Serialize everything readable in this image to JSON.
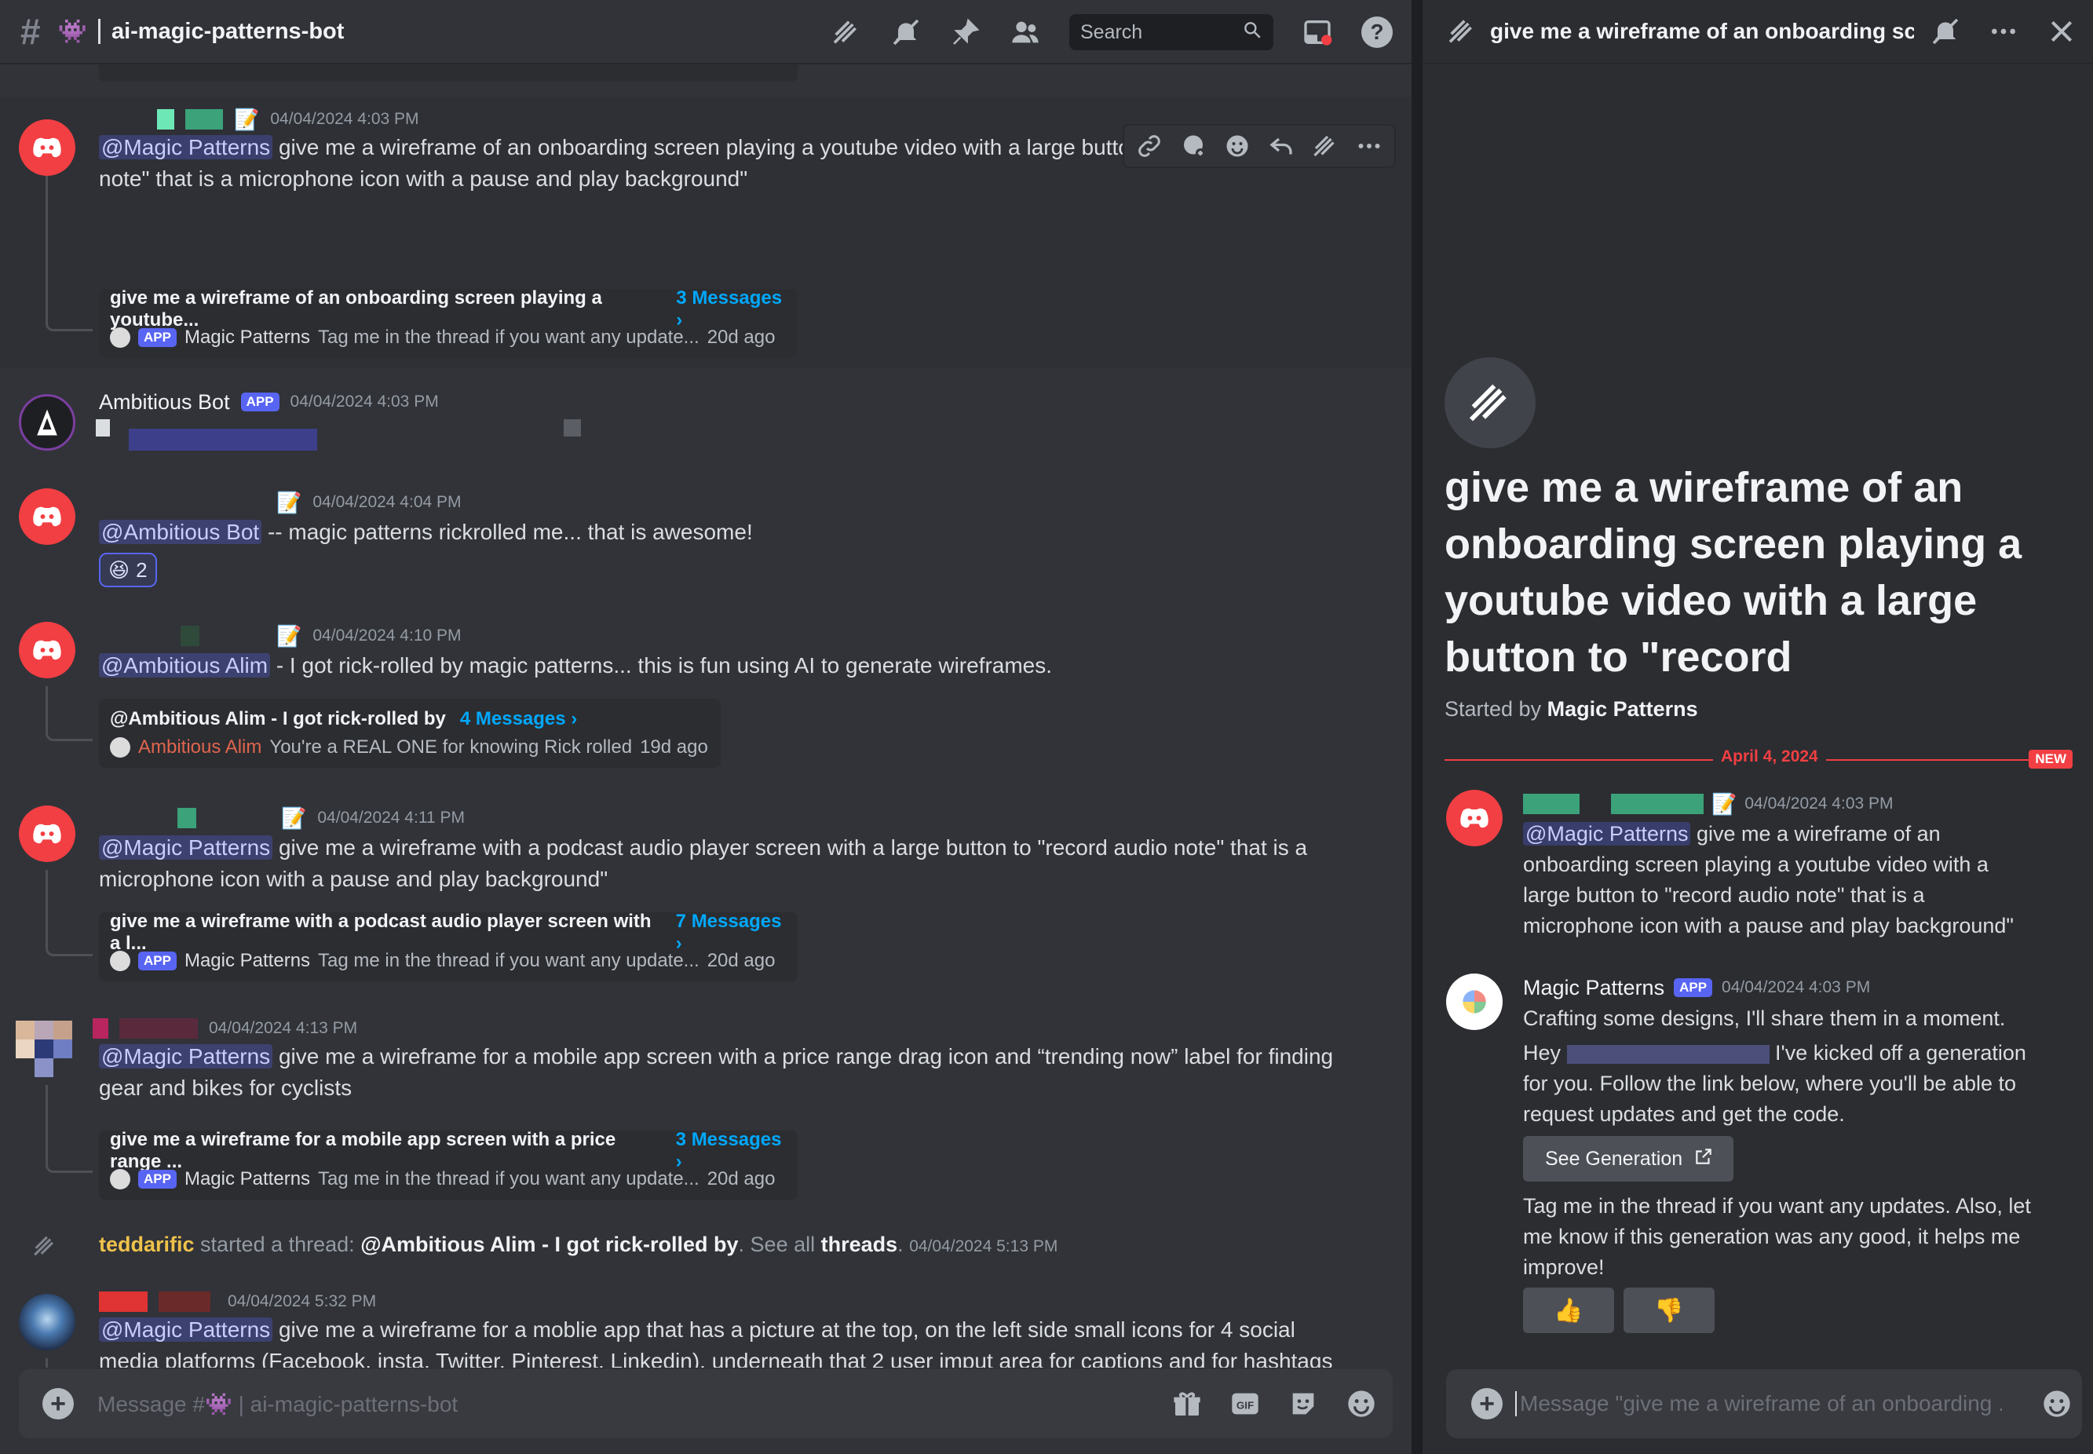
{
  "channel": {
    "title": "ai-magic-patterns-bot",
    "emoji": "👾",
    "search_placeholder": "Search"
  },
  "messages": [
    {
      "timestamp": "04/04/2024 4:03 PM",
      "mention": "@Magic Patterns",
      "text": "give me a wireframe of an onboarding screen playing a youtube video with a large button to \"record audio note\" that is a microphone icon with a pause and play background\"",
      "thread": {
        "name": "give me a wireframe of an onboarding screen playing a youtube...",
        "count": "3 Messages ›",
        "author_tag": "APP",
        "author": "Magic Patterns",
        "preview": "Tag me in the thread if you want any update...",
        "age": "20d ago"
      }
    },
    {
      "author": "Ambitious Bot",
      "tag": "APP",
      "timestamp": "04/04/2024 4:03 PM"
    },
    {
      "timestamp": "04/04/2024 4:04 PM",
      "mention": "@Ambitious Bot",
      "text": "-- magic patterns rickrolled me... that is awesome!",
      "reaction": {
        "emoji": "😆",
        "count": "2"
      }
    },
    {
      "timestamp": "04/04/2024 4:10 PM",
      "mention": "@Ambitious Alim",
      "text": "- I got rick-rolled by magic patterns... this is fun using AI to generate wireframes.",
      "thread": {
        "name": "@Ambitious Alim - I got rick-rolled by",
        "count": "4 Messages ›",
        "author": "Ambitious Alim",
        "preview": "You're a REAL ONE for knowing Rick rolled",
        "age": "19d ago"
      }
    },
    {
      "timestamp": "04/04/2024 4:11 PM",
      "mention": "@Magic Patterns",
      "text": "give me a wireframe with a podcast audio player screen with a large button to \"record audio note\" that is a microphone icon with a pause and play background\"",
      "thread": {
        "name": "give me a wireframe with a podcast audio player screen with a l...",
        "count": "7 Messages ›",
        "author_tag": "APP",
        "author": "Magic Patterns",
        "preview": "Tag me in the thread if you want any update...",
        "age": "20d ago"
      }
    },
    {
      "timestamp": "04/04/2024 4:13 PM",
      "mention": "@Magic Patterns",
      "text": "give me a  wireframe for a mobile app screen with a price range drag icon and “trending now” label for finding gear and bikes for cyclists",
      "thread": {
        "name": "give me a wireframe for a mobile app screen with a price range ...",
        "count": "3 Messages ›",
        "author_tag": "APP",
        "author": "Magic Patterns",
        "preview": "Tag me in the thread if you want any update...",
        "age": "20d ago"
      }
    },
    {
      "system": {
        "user": "teddarific",
        "action": "started a thread:",
        "thread_name": "@Ambitious Alim - I got rick-rolled by",
        "see_all": ". See all",
        "threads": "threads",
        "timestamp": "04/04/2024 5:13 PM"
      }
    },
    {
      "timestamp": "04/04/2024 5:32 PM",
      "mention": "@Magic Patterns",
      "text": "give me a wireframe for a moblie app that has a picture at the top, on the left side small icons for 4 social media platforms (Facebook, insta, Twitter, Pinterest, Linkedin). underneath that 2 user imput area for captions and for hashtags and at the bottom a link to a scheduler calendar."
    }
  ],
  "composer": {
    "placeholder": "Message #👾 | ai-magic-patterns-bot"
  },
  "thread_panel": {
    "title": "give me a wireframe of an onboarding scree",
    "hero_title": "give me a wireframe of an onboarding screen playing a youtube video with a large button to \"record",
    "started_by_label": "Started by",
    "started_by": "Magic Patterns",
    "date_divider": "April 4, 2024",
    "new_tag": "NEW",
    "msg1": {
      "timestamp": "04/04/2024 4:03 PM",
      "mention": "@Magic Patterns",
      "text": "give me a wireframe of an onboarding screen playing a youtube video with a large button to \"record audio note\" that is a microphone icon with a pause and play background\""
    },
    "msg2": {
      "author": "Magic Patterns",
      "tag": "APP",
      "timestamp": "04/04/2024 4:03 PM",
      "line1": "Crafting some designs, I'll share them in a moment.",
      "hey": "Hey",
      "line2": "I've kicked off a generation for you. Follow the link below, where you'll be able to request updates and get the code.",
      "button": "See Generation",
      "line3": "Tag me in the thread if you want any updates. Also, let me know if this generation was any good, it helps me improve!",
      "thumbs_up": "👍",
      "thumbs_down": "👎"
    },
    "composer_placeholder": "Message \"give me a wireframe of an onboarding ..."
  },
  "colors": {
    "background": "#313338",
    "accent": "#5865f2",
    "link": "#00a8fc",
    "alert": "#f23f43"
  }
}
